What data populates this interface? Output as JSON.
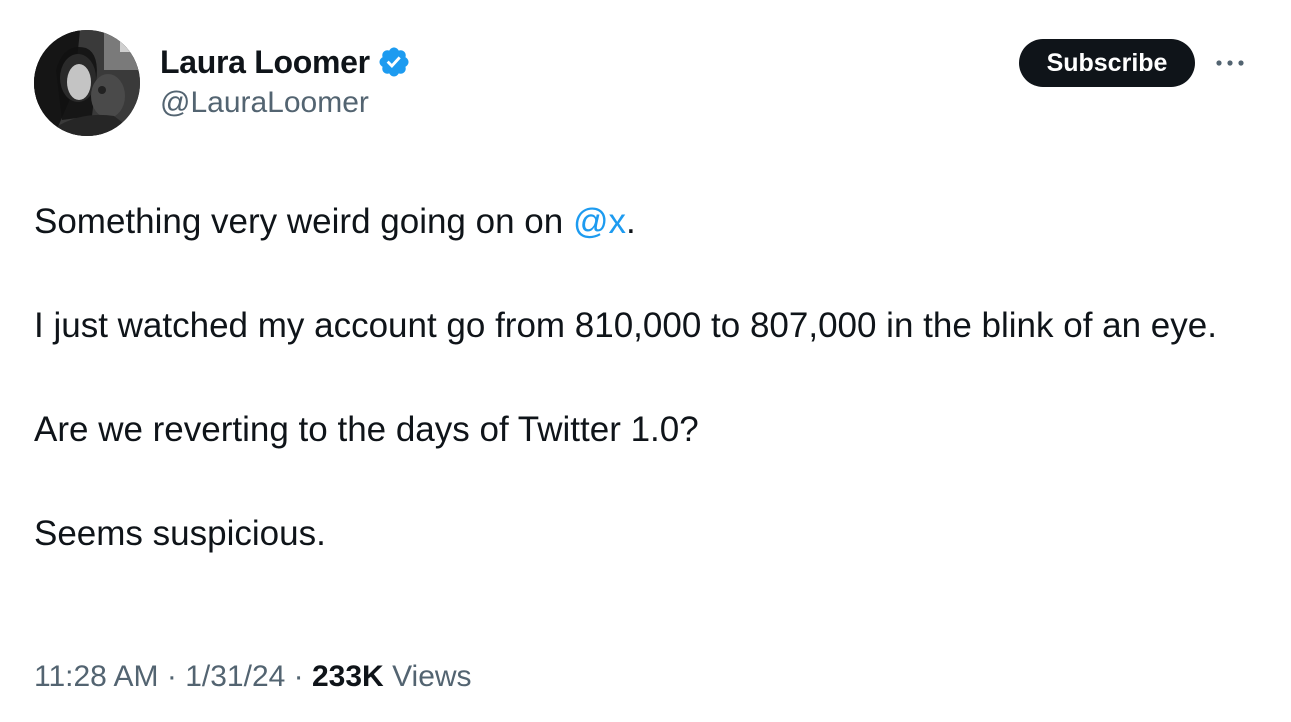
{
  "author": {
    "display_name": "Laura Loomer",
    "handle": "@LauraLoomer",
    "verified_icon": "verified-badge-icon"
  },
  "header": {
    "subscribe_label": "Subscribe",
    "more_icon": "more-horizontal-icon"
  },
  "post": {
    "line1_before": "Something very weird going on on ",
    "mention": "@x",
    "line1_after": ".",
    "paragraph2": "I just watched my account go from 810,000 to 807,000 in the blink of an eye.",
    "paragraph3": "Are we reverting to the days of Twitter 1.0?",
    "paragraph4": "Seems suspicious."
  },
  "meta": {
    "time": "11:28 AM",
    "separator": "·",
    "date": "1/31/24",
    "views_count": "233K",
    "views_label": "Views"
  },
  "colors": {
    "link": "#1d9bf0",
    "verified": "#1d9bf0",
    "secondary_text": "#536471",
    "primary_text": "#0f1419",
    "button_bg": "#0f1419"
  }
}
